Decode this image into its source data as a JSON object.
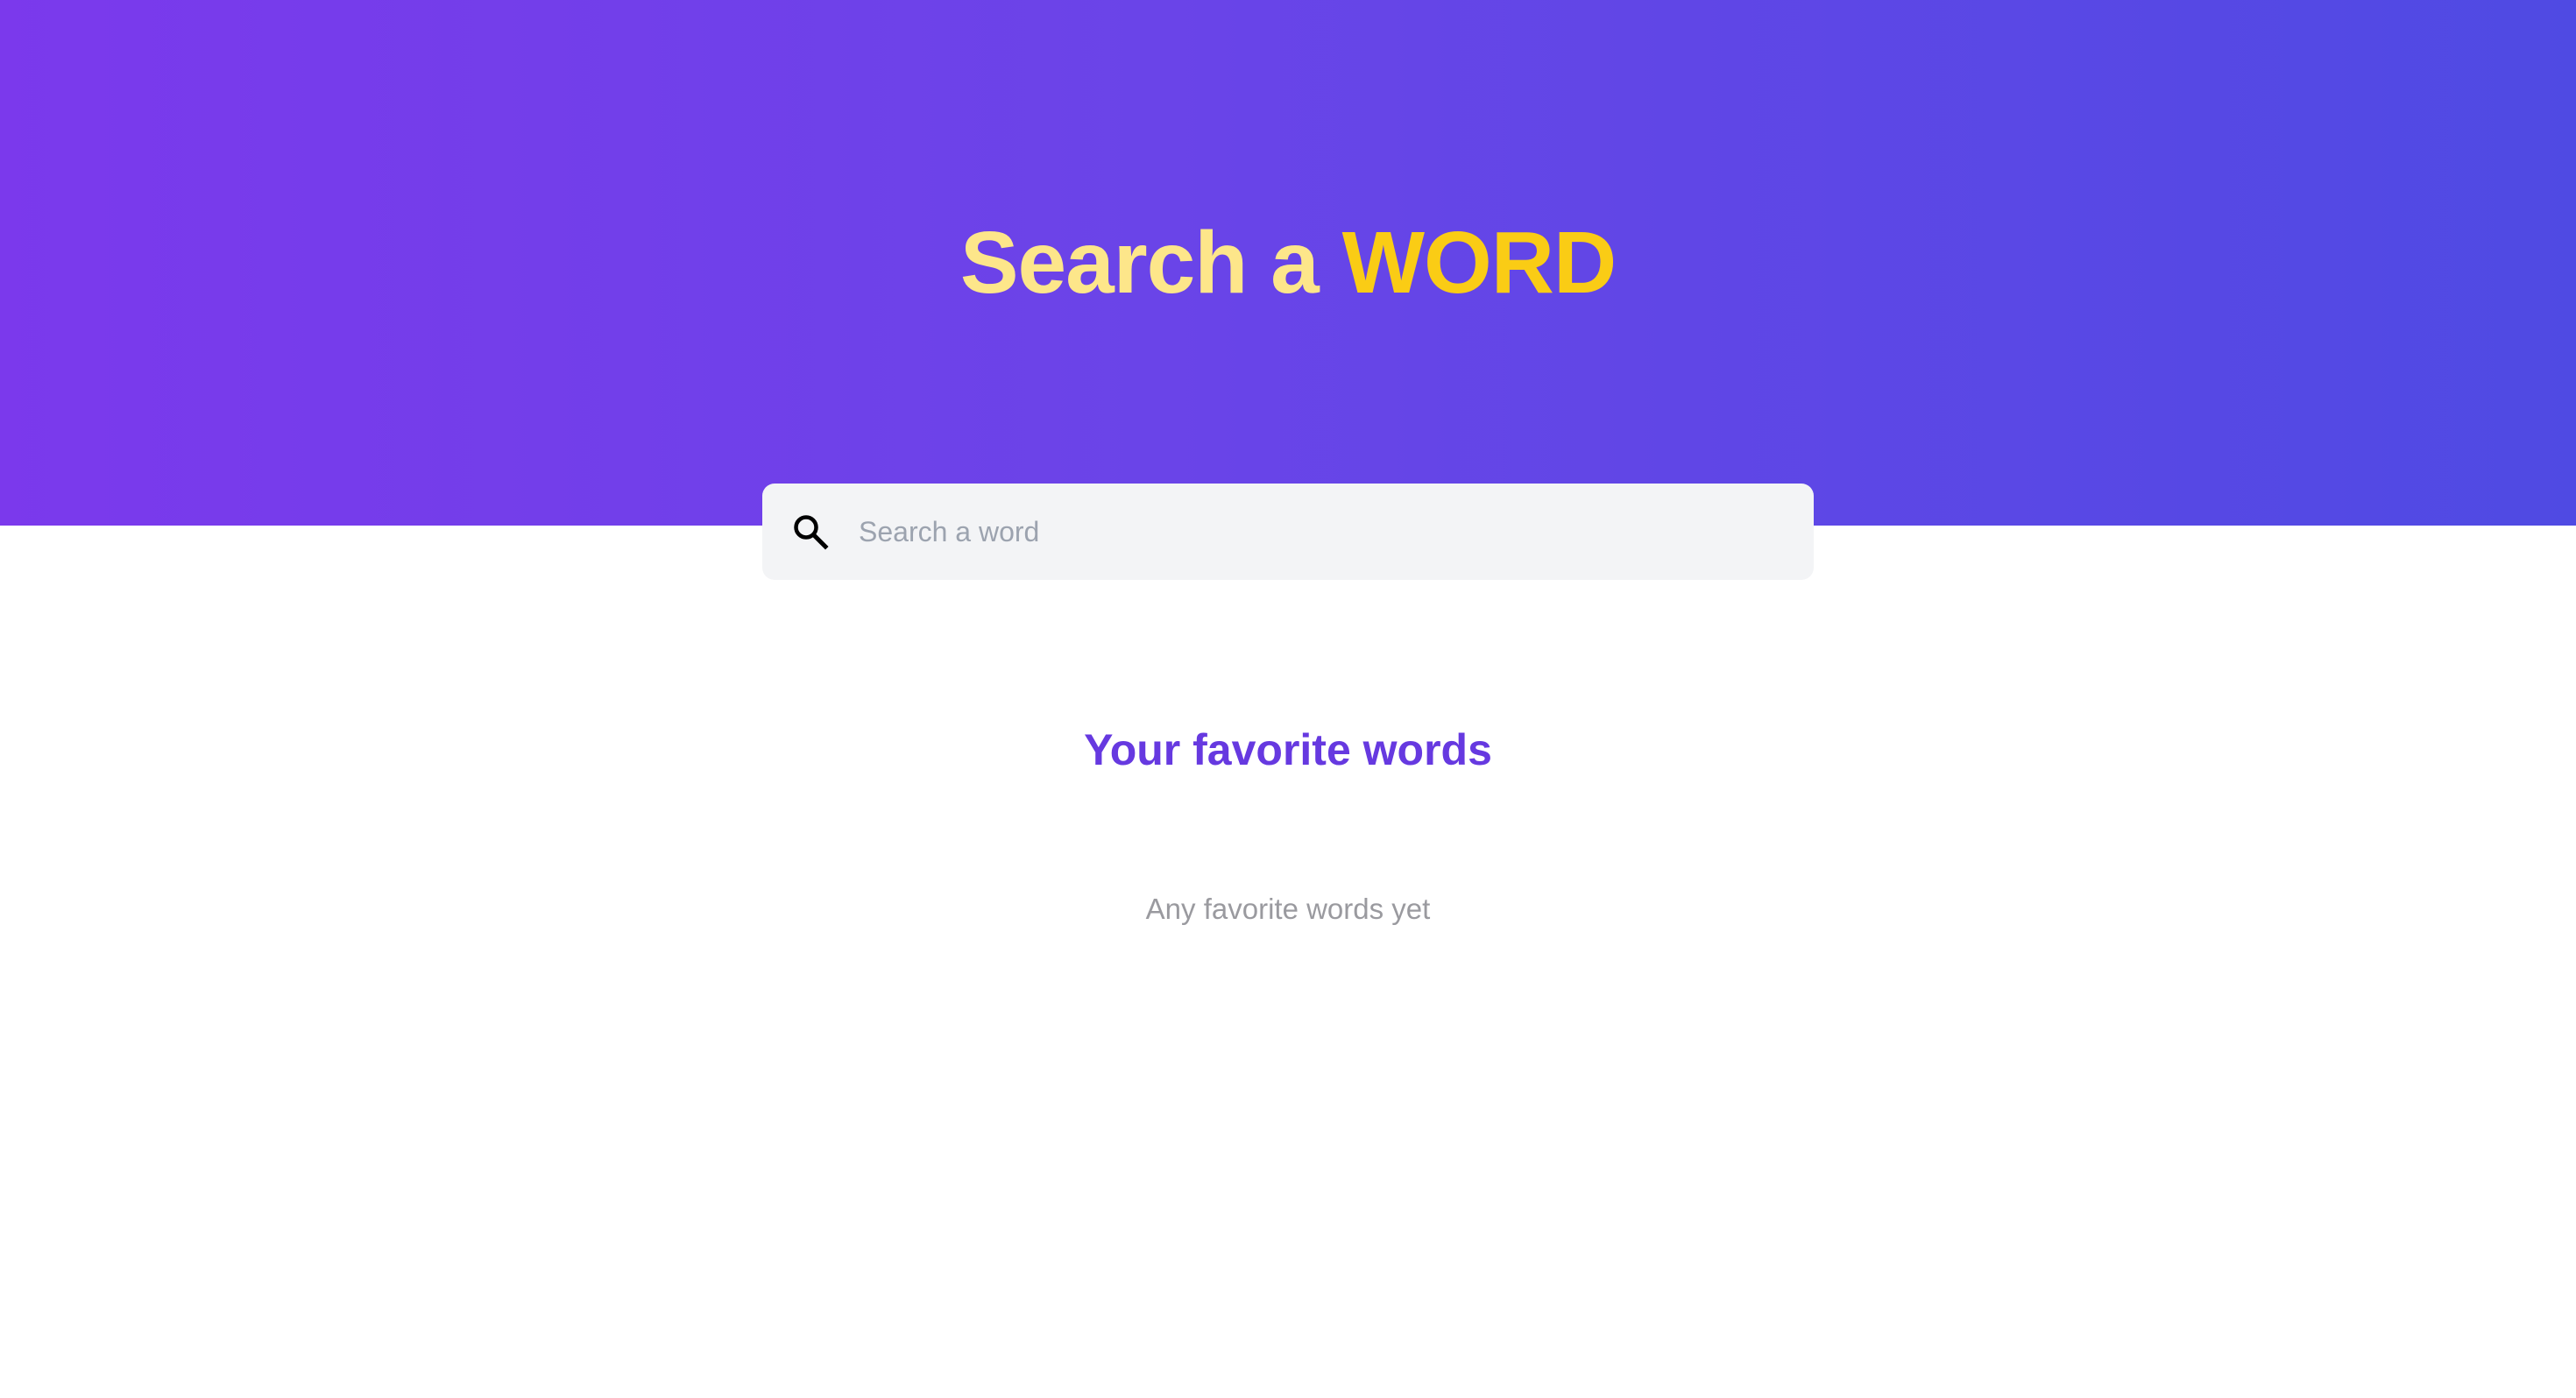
{
  "hero": {
    "title_part1": "Search a ",
    "title_part2": "WORD"
  },
  "search": {
    "placeholder": "Search a word",
    "value": "",
    "icon": "search-icon"
  },
  "favorites": {
    "title": "Your favorite words",
    "empty_message": "Any favorite words yet"
  },
  "colors": {
    "hero_gradient_start": "#7b39ec",
    "hero_gradient_end": "#4f4ae3",
    "title_light": "#fde68a",
    "title_accent": "#facc15",
    "favorites_title": "#6639e0",
    "search_background": "#f3f4f6",
    "muted_text": "#9a9a9f"
  }
}
